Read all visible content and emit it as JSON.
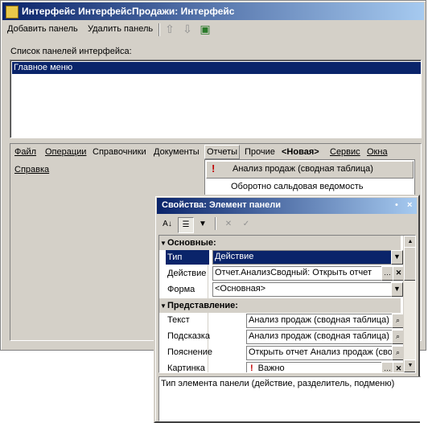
{
  "main_window": {
    "title": "Интерфейс ИнтерфейсПродажи: Интерфейс",
    "title_buttons": [
      "_",
      "□",
      "×"
    ],
    "toolbar": {
      "add_panel": "Добавить панель",
      "delete_panel": "Удалить панель",
      "icons": [
        "arrow-up-icon",
        "arrow-down-icon",
        "find-icon"
      ]
    },
    "panels_list_label": "Список панелей интерфейса:",
    "panels": [
      "Главное меню"
    ],
    "menu_items": [
      "Файл",
      "Операции",
      "Справочники",
      "Документы",
      "Отчеты",
      "Прочие",
      "<Новая>",
      "Сервис",
      "Окна"
    ],
    "menu_second_row": [
      "Справка"
    ],
    "active_menu": "Отчеты",
    "submenu_items": [
      "Анализ продаж (сводная таблица)",
      "Оборотно сальдовая ведомость"
    ]
  },
  "properties": {
    "title": "Свойства: Элемент панели",
    "title_buttons": [
      "•",
      "×"
    ],
    "toolbar_icons": [
      "sort-alpha-icon",
      "categorized-icon",
      "filter-icon",
      "clear-icon",
      "apply-icon"
    ],
    "group_basic": "Основные:",
    "group_view": "Представление:",
    "rows_basic": [
      {
        "label": "Тип",
        "value": "Действие"
      },
      {
        "label": "Действие",
        "value": "Отчет.АнализСводный: Открыть отчет"
      },
      {
        "label": "Форма",
        "value": "<Основная>"
      }
    ],
    "rows_view": [
      {
        "label": "Текст",
        "value": "Анализ продаж (сводная таблица)"
      },
      {
        "label": "Подсказка",
        "value": "Анализ продаж (сводная таблица)"
      },
      {
        "label": "Пояснение",
        "value": "Открыть отчет Анализ продаж (сво"
      },
      {
        "label": "Картинка",
        "value": "Важно"
      }
    ],
    "description": "Тип элемента панели (действие, разделитель, подменю)"
  }
}
